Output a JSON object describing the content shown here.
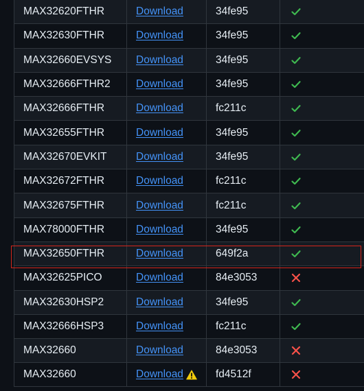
{
  "colors": {
    "link": "#4493f8",
    "pass": "#3fb950",
    "fail": "#f85149",
    "highlight_border": "#d7261c",
    "warning": "#f2cc0c"
  },
  "rows": [
    {
      "board": "MAX32620FTHR",
      "link": "Download",
      "hash": "34fe95",
      "status": "pass",
      "status_icon": "check-icon"
    },
    {
      "board": "MAX32630FTHR",
      "link": "Download",
      "hash": "34fe95",
      "status": "pass",
      "status_icon": "check-icon"
    },
    {
      "board": "MAX32660EVSYS",
      "link": "Download",
      "hash": "34fe95",
      "status": "pass",
      "status_icon": "check-icon"
    },
    {
      "board": "MAX32666FTHR2",
      "link": "Download",
      "hash": "34fe95",
      "status": "pass",
      "status_icon": "check-icon"
    },
    {
      "board": "MAX32666FTHR",
      "link": "Download",
      "hash": "fc211c",
      "status": "pass",
      "status_icon": "check-icon"
    },
    {
      "board": "MAX32655FTHR",
      "link": "Download",
      "hash": "34fe95",
      "status": "pass",
      "status_icon": "check-icon"
    },
    {
      "board": "MAX32670EVKIT",
      "link": "Download",
      "hash": "34fe95",
      "status": "pass",
      "status_icon": "check-icon"
    },
    {
      "board": "MAX32672FTHR",
      "link": "Download",
      "hash": "fc211c",
      "status": "pass",
      "status_icon": "check-icon"
    },
    {
      "board": "MAX32675FTHR",
      "link": "Download",
      "hash": "fc211c",
      "status": "pass",
      "status_icon": "check-icon"
    },
    {
      "board": "MAX78000FTHR",
      "link": "Download",
      "hash": "34fe95",
      "status": "pass",
      "status_icon": "check-icon"
    },
    {
      "board": "MAX32650FTHR",
      "link": "Download",
      "hash": "649f2a",
      "status": "pass",
      "status_icon": "check-icon",
      "highlighted": true
    },
    {
      "board": "MAX32625PICO",
      "link": "Download",
      "hash": "84e3053",
      "status": "fail",
      "status_icon": "cross-icon"
    },
    {
      "board": "MAX32630HSP2",
      "link": "Download",
      "hash": "34fe95",
      "status": "pass",
      "status_icon": "check-icon"
    },
    {
      "board": "MAX32666HSP3",
      "link": "Download",
      "hash": "fc211c",
      "status": "pass",
      "status_icon": "check-icon"
    },
    {
      "board": "MAX32660",
      "link": "Download",
      "hash": "84e3053",
      "status": "fail",
      "status_icon": "cross-icon"
    },
    {
      "board": "MAX32660",
      "link": "Download",
      "hash": "fd4512f",
      "status": "fail",
      "status_icon": "cross-icon",
      "warning_icon": "warning-icon"
    }
  ]
}
